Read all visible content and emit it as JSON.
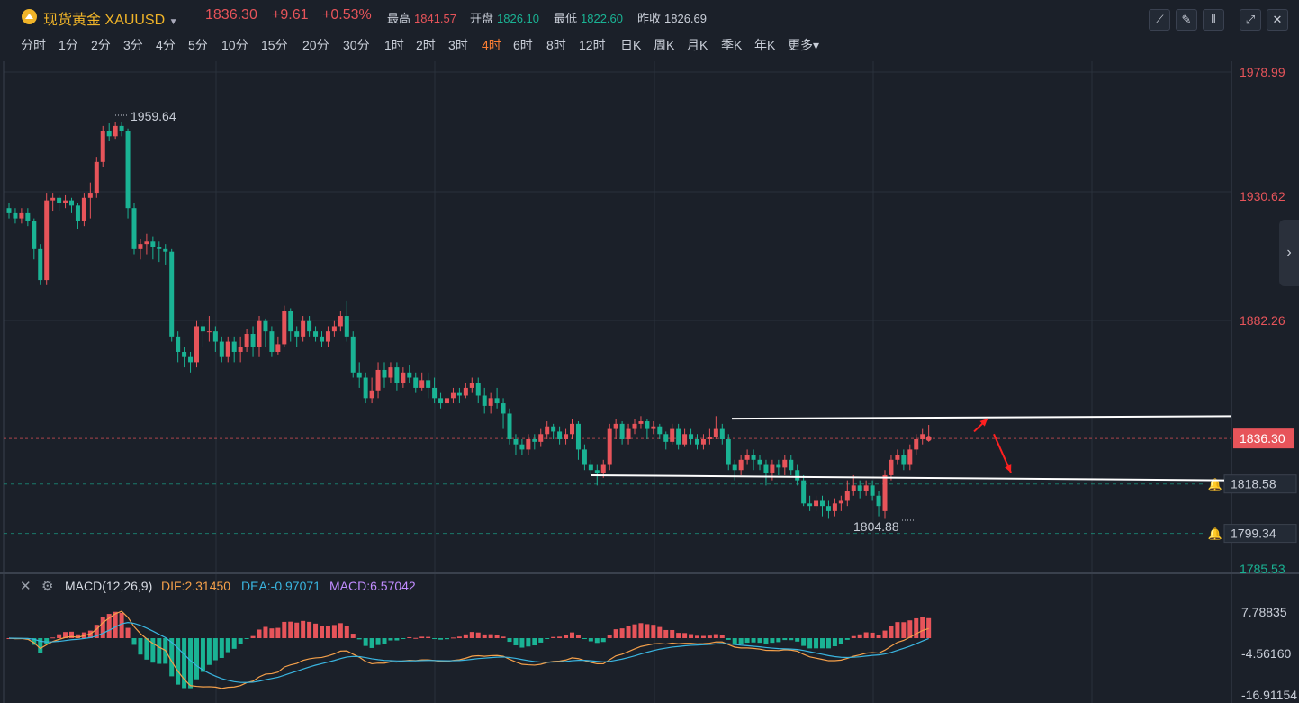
{
  "header": {
    "name": "现货黄金",
    "symbol": "XAUUSD",
    "price": "1836.30",
    "change": "+9.61",
    "change_pct": "+0.53%",
    "high_label": "最高",
    "high": "1841.57",
    "open_label": "开盘",
    "open": "1826.10",
    "low_label": "最低",
    "low": "1822.60",
    "prev_label": "昨收",
    "prev": "1826.69",
    "tools": [
      {
        "icon": "line-tool-icon",
        "glyph": "⟋"
      },
      {
        "icon": "pen-tool-icon",
        "glyph": "✎"
      },
      {
        "icon": "candle-type-icon",
        "glyph": "⫴"
      },
      {
        "icon": "expand-icon",
        "glyph": "⤢"
      },
      {
        "icon": "close-icon",
        "glyph": "✕"
      }
    ]
  },
  "periods": [
    "分时",
    "1分",
    "2分",
    "3分",
    "4分",
    "5分",
    "10分",
    "15分",
    "20分",
    "30分",
    "1时",
    "2时",
    "3时",
    "4时",
    "6时",
    "8时",
    "12时",
    "日K",
    "周K",
    "月K",
    "季K",
    "年K",
    "更多"
  ],
  "active_period": "4时",
  "colors": {
    "up": "#e7545a",
    "down": "#1ab394",
    "dif": "#f5a04a",
    "dea": "#3ab5e0",
    "macd": "#c18cff",
    "bg": "#1b2029",
    "grid": "#2a313c"
  },
  "chart_data": {
    "type": "candlestick",
    "price_axis": {
      "ticks": [
        "1978.99",
        "1930.62",
        "1882.26",
        "1818.58",
        "1799.34",
        "1785.53"
      ]
    },
    "current_price_tag": "1836.30",
    "alert_levels": [
      "1818.58",
      "1799.34"
    ],
    "annotations": {
      "high_label": "1959.64",
      "low_label": "1804.88"
    },
    "lines": [
      {
        "from": [
          813,
          1844
        ],
        "to": [
          1368,
          1845
        ],
        "color": "#ffffff"
      },
      {
        "from": [
          656,
          1822
        ],
        "to": [
          1360,
          1820
        ],
        "color": "#ffffff"
      }
    ],
    "arrows": [
      {
        "from": [
          1082,
          1839
        ],
        "to": [
          1097,
          1844
        ],
        "color": "#ff2020"
      },
      {
        "from": [
          1104,
          1838
        ],
        "to": [
          1123,
          1823
        ],
        "color": "#ff2020"
      }
    ],
    "candles": [
      {
        "o": 1926,
        "c": 1924,
        "h": 1928,
        "l": 1922
      },
      {
        "o": 1924,
        "c": 1922,
        "h": 1926,
        "l": 1920
      },
      {
        "o": 1922,
        "c": 1924,
        "h": 1926,
        "l": 1920
      },
      {
        "o": 1924,
        "c": 1921,
        "h": 1926,
        "l": 1919
      },
      {
        "o": 1921,
        "c": 1910,
        "h": 1922,
        "l": 1906
      },
      {
        "o": 1910,
        "c": 1898,
        "h": 1912,
        "l": 1896
      },
      {
        "o": 1898,
        "c": 1929,
        "h": 1932,
        "l": 1896
      },
      {
        "o": 1929,
        "c": 1930,
        "h": 1932,
        "l": 1925
      },
      {
        "o": 1930,
        "c": 1928,
        "h": 1931,
        "l": 1925
      },
      {
        "o": 1928,
        "c": 1929,
        "h": 1931,
        "l": 1926
      },
      {
        "o": 1929,
        "c": 1927,
        "h": 1930,
        "l": 1924
      },
      {
        "o": 1927,
        "c": 1921,
        "h": 1928,
        "l": 1918
      },
      {
        "o": 1921,
        "c": 1930,
        "h": 1932,
        "l": 1919
      },
      {
        "o": 1930,
        "c": 1932,
        "h": 1936,
        "l": 1922
      },
      {
        "o": 1932,
        "c": 1944,
        "h": 1946,
        "l": 1930
      },
      {
        "o": 1944,
        "c": 1956,
        "h": 1958,
        "l": 1942
      },
      {
        "o": 1956,
        "c": 1954,
        "h": 1959,
        "l": 1952
      },
      {
        "o": 1954,
        "c": 1958,
        "h": 1959.6,
        "l": 1953
      },
      {
        "o": 1958,
        "c": 1956,
        "h": 1959.6,
        "l": 1954
      },
      {
        "o": 1956,
        "c": 1926,
        "h": 1957,
        "l": 1922
      },
      {
        "o": 1926,
        "c": 1910,
        "h": 1928,
        "l": 1908
      },
      {
        "o": 1910,
        "c": 1912,
        "h": 1914,
        "l": 1906
      },
      {
        "o": 1912,
        "c": 1913,
        "h": 1916,
        "l": 1908
      },
      {
        "o": 1913,
        "c": 1911,
        "h": 1915,
        "l": 1906
      },
      {
        "o": 1911,
        "c": 1910,
        "h": 1913,
        "l": 1905
      },
      {
        "o": 1910,
        "c": 1909,
        "h": 1912,
        "l": 1904
      },
      {
        "o": 1909,
        "c": 1876,
        "h": 1910,
        "l": 1874
      },
      {
        "o": 1876,
        "c": 1870,
        "h": 1878,
        "l": 1866
      },
      {
        "o": 1870,
        "c": 1868,
        "h": 1872,
        "l": 1864
      },
      {
        "o": 1868,
        "c": 1866,
        "h": 1870,
        "l": 1862
      },
      {
        "o": 1866,
        "c": 1880,
        "h": 1882,
        "l": 1864
      },
      {
        "o": 1880,
        "c": 1878,
        "h": 1882,
        "l": 1872
      },
      {
        "o": 1878,
        "c": 1878,
        "h": 1884,
        "l": 1874
      },
      {
        "o": 1878,
        "c": 1874,
        "h": 1880,
        "l": 1870
      },
      {
        "o": 1874,
        "c": 1868,
        "h": 1876,
        "l": 1866
      },
      {
        "o": 1868,
        "c": 1874,
        "h": 1876,
        "l": 1866
      },
      {
        "o": 1874,
        "c": 1870,
        "h": 1876,
        "l": 1866
      },
      {
        "o": 1870,
        "c": 1872,
        "h": 1876,
        "l": 1866
      },
      {
        "o": 1872,
        "c": 1877,
        "h": 1879,
        "l": 1870
      },
      {
        "o": 1877,
        "c": 1872,
        "h": 1880,
        "l": 1868
      },
      {
        "o": 1872,
        "c": 1882,
        "h": 1884,
        "l": 1868
      },
      {
        "o": 1882,
        "c": 1878,
        "h": 1883,
        "l": 1872
      },
      {
        "o": 1878,
        "c": 1870,
        "h": 1880,
        "l": 1868
      },
      {
        "o": 1870,
        "c": 1873,
        "h": 1876,
        "l": 1869
      },
      {
        "o": 1873,
        "c": 1886,
        "h": 1888,
        "l": 1872
      },
      {
        "o": 1886,
        "c": 1878,
        "h": 1887,
        "l": 1874
      },
      {
        "o": 1878,
        "c": 1876,
        "h": 1880,
        "l": 1872
      },
      {
        "o": 1876,
        "c": 1882,
        "h": 1884,
        "l": 1874
      },
      {
        "o": 1882,
        "c": 1878,
        "h": 1884,
        "l": 1876
      },
      {
        "o": 1878,
        "c": 1876,
        "h": 1880,
        "l": 1874
      },
      {
        "o": 1876,
        "c": 1874,
        "h": 1878,
        "l": 1872
      },
      {
        "o": 1874,
        "c": 1878,
        "h": 1880,
        "l": 1872
      },
      {
        "o": 1878,
        "c": 1880,
        "h": 1882,
        "l": 1876
      },
      {
        "o": 1880,
        "c": 1884,
        "h": 1886,
        "l": 1878
      },
      {
        "o": 1884,
        "c": 1876,
        "h": 1890,
        "l": 1874
      },
      {
        "o": 1876,
        "c": 1862,
        "h": 1878,
        "l": 1860
      },
      {
        "o": 1862,
        "c": 1860,
        "h": 1866,
        "l": 1856
      },
      {
        "o": 1860,
        "c": 1852,
        "h": 1862,
        "l": 1850
      },
      {
        "o": 1852,
        "c": 1855,
        "h": 1860,
        "l": 1850
      },
      {
        "o": 1855,
        "c": 1863,
        "h": 1866,
        "l": 1852
      },
      {
        "o": 1863,
        "c": 1860,
        "h": 1866,
        "l": 1856
      },
      {
        "o": 1860,
        "c": 1864,
        "h": 1866,
        "l": 1858
      },
      {
        "o": 1864,
        "c": 1858,
        "h": 1866,
        "l": 1855
      },
      {
        "o": 1858,
        "c": 1862,
        "h": 1864,
        "l": 1856
      },
      {
        "o": 1862,
        "c": 1860,
        "h": 1865,
        "l": 1858
      },
      {
        "o": 1860,
        "c": 1856,
        "h": 1862,
        "l": 1854
      },
      {
        "o": 1856,
        "c": 1859,
        "h": 1862,
        "l": 1855
      },
      {
        "o": 1859,
        "c": 1856,
        "h": 1862,
        "l": 1852
      },
      {
        "o": 1856,
        "c": 1852,
        "h": 1860,
        "l": 1850
      },
      {
        "o": 1852,
        "c": 1850,
        "h": 1854,
        "l": 1848
      },
      {
        "o": 1850,
        "c": 1852,
        "h": 1855,
        "l": 1848
      },
      {
        "o": 1852,
        "c": 1854,
        "h": 1856,
        "l": 1850
      },
      {
        "o": 1854,
        "c": 1853,
        "h": 1856,
        "l": 1850
      },
      {
        "o": 1853,
        "c": 1856,
        "h": 1858,
        "l": 1852
      },
      {
        "o": 1856,
        "c": 1858,
        "h": 1860,
        "l": 1854
      },
      {
        "o": 1858,
        "c": 1853,
        "h": 1860,
        "l": 1850
      },
      {
        "o": 1853,
        "c": 1849,
        "h": 1856,
        "l": 1846
      },
      {
        "o": 1849,
        "c": 1852,
        "h": 1854,
        "l": 1846
      },
      {
        "o": 1852,
        "c": 1850,
        "h": 1856,
        "l": 1848
      },
      {
        "o": 1850,
        "c": 1846,
        "h": 1852,
        "l": 1840
      },
      {
        "o": 1846,
        "c": 1836,
        "h": 1848,
        "l": 1834
      },
      {
        "o": 1836,
        "c": 1834,
        "h": 1838,
        "l": 1830
      },
      {
        "o": 1834,
        "c": 1832,
        "h": 1836,
        "l": 1830
      },
      {
        "o": 1832,
        "c": 1836,
        "h": 1838,
        "l": 1830
      },
      {
        "o": 1836,
        "c": 1835,
        "h": 1838,
        "l": 1832
      },
      {
        "o": 1835,
        "c": 1838,
        "h": 1840,
        "l": 1833
      },
      {
        "o": 1838,
        "c": 1841,
        "h": 1843,
        "l": 1836
      },
      {
        "o": 1841,
        "c": 1839,
        "h": 1842,
        "l": 1836
      },
      {
        "o": 1839,
        "c": 1836,
        "h": 1841,
        "l": 1834
      },
      {
        "o": 1836,
        "c": 1838,
        "h": 1840,
        "l": 1834
      },
      {
        "o": 1838,
        "c": 1842,
        "h": 1844,
        "l": 1836
      },
      {
        "o": 1842,
        "c": 1832,
        "h": 1843,
        "l": 1828
      },
      {
        "o": 1832,
        "c": 1826,
        "h": 1834,
        "l": 1824
      },
      {
        "o": 1826,
        "c": 1824,
        "h": 1828,
        "l": 1822
      },
      {
        "o": 1824,
        "c": 1823,
        "h": 1826,
        "l": 1818
      },
      {
        "o": 1823,
        "c": 1826,
        "h": 1828,
        "l": 1821
      },
      {
        "o": 1826,
        "c": 1840,
        "h": 1842,
        "l": 1824
      },
      {
        "o": 1840,
        "c": 1842,
        "h": 1844,
        "l": 1836
      },
      {
        "o": 1842,
        "c": 1836,
        "h": 1843,
        "l": 1834
      },
      {
        "o": 1836,
        "c": 1840,
        "h": 1842,
        "l": 1834
      },
      {
        "o": 1840,
        "c": 1842,
        "h": 1844,
        "l": 1838
      },
      {
        "o": 1842,
        "c": 1843,
        "h": 1845,
        "l": 1840
      },
      {
        "o": 1843,
        "c": 1840,
        "h": 1844,
        "l": 1836
      },
      {
        "o": 1840,
        "c": 1841,
        "h": 1843,
        "l": 1838
      },
      {
        "o": 1841,
        "c": 1838,
        "h": 1842,
        "l": 1836
      },
      {
        "o": 1838,
        "c": 1835,
        "h": 1839,
        "l": 1832
      },
      {
        "o": 1835,
        "c": 1840,
        "h": 1842,
        "l": 1834
      },
      {
        "o": 1840,
        "c": 1834,
        "h": 1842,
        "l": 1832
      },
      {
        "o": 1834,
        "c": 1838,
        "h": 1840,
        "l": 1833
      },
      {
        "o": 1838,
        "c": 1836,
        "h": 1840,
        "l": 1834
      },
      {
        "o": 1836,
        "c": 1834,
        "h": 1838,
        "l": 1832
      },
      {
        "o": 1834,
        "c": 1836,
        "h": 1838,
        "l": 1832
      },
      {
        "o": 1836,
        "c": 1837,
        "h": 1840,
        "l": 1834
      },
      {
        "o": 1837,
        "c": 1840,
        "h": 1845,
        "l": 1836
      },
      {
        "o": 1840,
        "c": 1836,
        "h": 1842,
        "l": 1834
      },
      {
        "o": 1836,
        "c": 1826,
        "h": 1838,
        "l": 1824
      },
      {
        "o": 1826,
        "c": 1824,
        "h": 1828,
        "l": 1820
      },
      {
        "o": 1824,
        "c": 1828,
        "h": 1830,
        "l": 1822
      },
      {
        "o": 1828,
        "c": 1830,
        "h": 1832,
        "l": 1826
      },
      {
        "o": 1830,
        "c": 1828,
        "h": 1832,
        "l": 1824
      },
      {
        "o": 1828,
        "c": 1826,
        "h": 1830,
        "l": 1824
      },
      {
        "o": 1826,
        "c": 1823,
        "h": 1828,
        "l": 1818
      },
      {
        "o": 1823,
        "c": 1826,
        "h": 1828,
        "l": 1820
      },
      {
        "o": 1826,
        "c": 1825,
        "h": 1828,
        "l": 1822
      },
      {
        "o": 1825,
        "c": 1828,
        "h": 1830,
        "l": 1822
      },
      {
        "o": 1828,
        "c": 1824,
        "h": 1830,
        "l": 1822
      },
      {
        "o": 1824,
        "c": 1820,
        "h": 1826,
        "l": 1818
      },
      {
        "o": 1820,
        "c": 1811,
        "h": 1822,
        "l": 1810
      },
      {
        "o": 1811,
        "c": 1810,
        "h": 1814,
        "l": 1808
      },
      {
        "o": 1810,
        "c": 1812,
        "h": 1814,
        "l": 1808
      },
      {
        "o": 1812,
        "c": 1810,
        "h": 1814,
        "l": 1806
      },
      {
        "o": 1810,
        "c": 1808,
        "h": 1812,
        "l": 1805
      },
      {
        "o": 1808,
        "c": 1811,
        "h": 1813,
        "l": 1806
      },
      {
        "o": 1811,
        "c": 1812,
        "h": 1814,
        "l": 1808
      },
      {
        "o": 1812,
        "c": 1816,
        "h": 1820,
        "l": 1810
      },
      {
        "o": 1816,
        "c": 1818,
        "h": 1822,
        "l": 1814
      },
      {
        "o": 1818,
        "c": 1816,
        "h": 1820,
        "l": 1813
      },
      {
        "o": 1816,
        "c": 1818,
        "h": 1820,
        "l": 1814
      },
      {
        "o": 1818,
        "c": 1814,
        "h": 1820,
        "l": 1812
      },
      {
        "o": 1814,
        "c": 1810,
        "h": 1816,
        "l": 1806
      },
      {
        "o": 1808,
        "c": 1822,
        "h": 1824,
        "l": 1805
      },
      {
        "o": 1822,
        "c": 1828,
        "h": 1830,
        "l": 1820
      },
      {
        "o": 1828,
        "c": 1830,
        "h": 1832,
        "l": 1826
      },
      {
        "o": 1830,
        "c": 1826,
        "h": 1832,
        "l": 1824
      },
      {
        "o": 1826,
        "c": 1832,
        "h": 1834,
        "l": 1824
      },
      {
        "o": 1832,
        "c": 1836,
        "h": 1838,
        "l": 1830
      },
      {
        "o": 1836,
        "c": 1838,
        "h": 1840,
        "l": 1834
      },
      {
        "o": 1836,
        "c": 1836.3,
        "h": 1841.6,
        "l": 1835
      }
    ],
    "macd": {
      "label": "MACD(12,26,9)",
      "dif_label": "DIF:",
      "dif": "2.31450",
      "dea_label": "DEA:",
      "dea": "-0.97071",
      "macd_label": "MACD:",
      "macd": "6.57042",
      "axis_ticks": [
        "7.78835",
        "-4.56160",
        "-16.91154"
      ],
      "axis_range": [
        -16.91154,
        7.78835
      ]
    }
  }
}
